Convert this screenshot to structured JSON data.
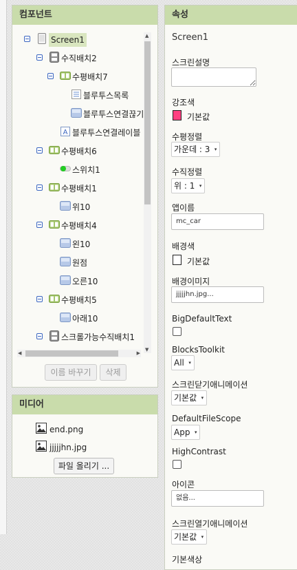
{
  "components": {
    "title": "컴포넌트",
    "tree": [
      {
        "label": "Screen1",
        "icon": "screen-icon",
        "selected": true
      },
      {
        "label": "수직배치2",
        "icon": "vertical-arrangement-icon"
      },
      {
        "label": "수평배치7",
        "icon": "horizontal-arrangement-icon"
      },
      {
        "label": "블루투스목록",
        "icon": "listpicker-icon"
      },
      {
        "label": "블루투스연결끊기",
        "icon": "button-icon"
      },
      {
        "label": "블루투스연결레이블",
        "icon": "label-icon"
      },
      {
        "label": "수평배치6",
        "icon": "horizontal-arrangement-icon"
      },
      {
        "label": "스위치1",
        "icon": "switch-icon"
      },
      {
        "label": "수평배치1",
        "icon": "horizontal-arrangement-icon"
      },
      {
        "label": "위10",
        "icon": "button-icon"
      },
      {
        "label": "수평배치4",
        "icon": "horizontal-arrangement-icon"
      },
      {
        "label": "왼10",
        "icon": "button-icon"
      },
      {
        "label": "원점",
        "icon": "button-icon"
      },
      {
        "label": "오른10",
        "icon": "button-icon"
      },
      {
        "label": "수평배치5",
        "icon": "horizontal-arrangement-icon"
      },
      {
        "label": "아래10",
        "icon": "button-icon"
      },
      {
        "label": "스크롤가능수직배치1",
        "icon": "scroll-arrangement-icon"
      }
    ],
    "rename_label": "이름 바꾸기",
    "delete_label": "삭제"
  },
  "media": {
    "title": "미디어",
    "files": [
      {
        "name": "end.png",
        "icon": "image-file-icon"
      },
      {
        "name": "jjjjjhn.jpg",
        "icon": "image-file-icon"
      }
    ],
    "upload_label": "파일 올리기 ..."
  },
  "properties": {
    "title": "속성",
    "screen_name": "Screen1",
    "items": {
      "about_screen": {
        "label": "스크린설명",
        "value": ""
      },
      "accent_color": {
        "label": "강조색",
        "value": "기본값",
        "color": "#ff4081"
      },
      "align_horizontal": {
        "label": "수평정렬",
        "value": "가운데 : 3"
      },
      "align_vertical": {
        "label": "수직정렬",
        "value": "위 : 1"
      },
      "app_name": {
        "label": "앱이름",
        "value": "mc_car"
      },
      "background_color": {
        "label": "배경색",
        "value": "기본값",
        "color": "#ffffff"
      },
      "background_image": {
        "label": "배경이미지",
        "value": "jjjjjhn.jpg..."
      },
      "big_default_text": {
        "label": "BigDefaultText"
      },
      "blocks_toolkit": {
        "label": "BlocksToolkit",
        "value": "All"
      },
      "close_animation": {
        "label": "스크린닫기애니메이션",
        "value": "기본값"
      },
      "default_file_scope": {
        "label": "DefaultFileScope",
        "value": "App"
      },
      "high_contrast": {
        "label": "HighContrast"
      },
      "icon": {
        "label": "아이콘",
        "value": "없음..."
      },
      "open_animation": {
        "label": "스크린열기애니메이션",
        "value": "기본값"
      },
      "primary_color": {
        "label": "기본색상"
      }
    }
  },
  "icons": {
    "collapse": "collapse-toggle-icon",
    "scroll_up": "▲",
    "scroll_down": "▼",
    "scroll_left": "◀",
    "scroll_right": "▶",
    "caret": "▾"
  }
}
